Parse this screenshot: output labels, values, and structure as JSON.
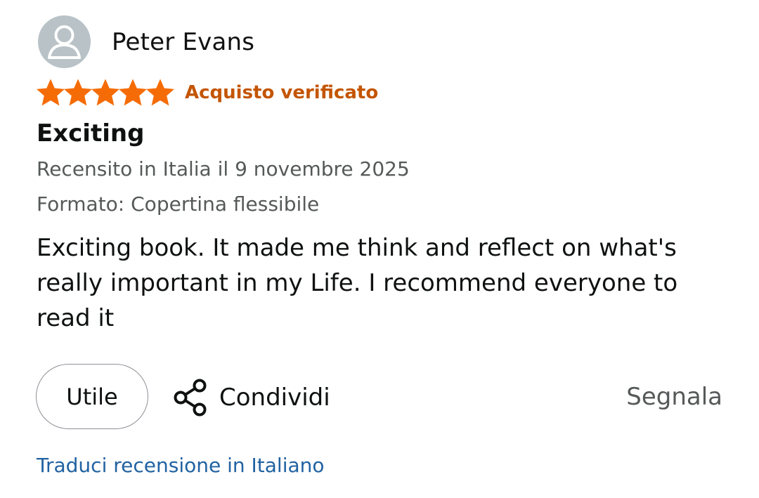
{
  "reviewer": {
    "name": "Peter Evans",
    "avatar_icon": "person-silhouette-icon"
  },
  "rating": {
    "stars": 5,
    "max_stars": 5,
    "star_color": "#f56c06",
    "verified_label": "Acquisto verificato",
    "verified_color": "#c45500"
  },
  "review": {
    "title": "Exciting",
    "date": "Recensito in Italia il 9 novembre 2025",
    "format": "Formato: Copertina flessibile",
    "body": "Exciting book. It made me think and reflect on what's really important in my Life. I recommend everyone to read it"
  },
  "actions": {
    "helpful_label": "Utile",
    "share_label": "Condividi",
    "share_icon": "share-icon",
    "report_label": "Segnala"
  },
  "translate": {
    "label": "Traduci recensione in Italiano",
    "color": "#2162a1"
  }
}
